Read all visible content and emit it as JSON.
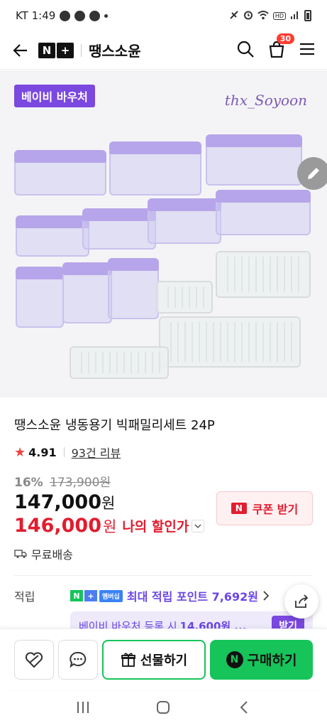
{
  "status_bar": {
    "carrier_time": "KT 1:49",
    "hd": "HD"
  },
  "header": {
    "logo": [
      "N",
      "+"
    ],
    "store_name": "땡스소윤",
    "cart_count": "30"
  },
  "product_image": {
    "voucher_tag": "베이비 바우처",
    "signature": "thx_Soyoon"
  },
  "product": {
    "title": "땡스소윤 냉동용기 빅패밀리세트 24P",
    "rating": "4.91",
    "review_link": "93건 리뷰",
    "discount_rate": "16%",
    "original_price": "173,900원",
    "sale_price": "147,000",
    "sale_price_unit": "원",
    "my_price": "146,000",
    "my_price_unit": "원",
    "my_price_label": "나의 할인가",
    "shipping": "무료배송"
  },
  "coupon": {
    "label": "쿠폰 받기",
    "n": "N"
  },
  "points": {
    "label": "적립",
    "badge_n": "N",
    "badge_plus": "+",
    "badge_member": "멤버십",
    "detail": "최대 적립 포인트 7,692원"
  },
  "voucher_banner": {
    "text": "베이비 바우처 등록 시",
    "amount": "14,600원 ...",
    "get_label": "받기"
  },
  "action_bar": {
    "gift_label": "선물하기",
    "buy_label": "구매하기",
    "buy_n": "N"
  }
}
